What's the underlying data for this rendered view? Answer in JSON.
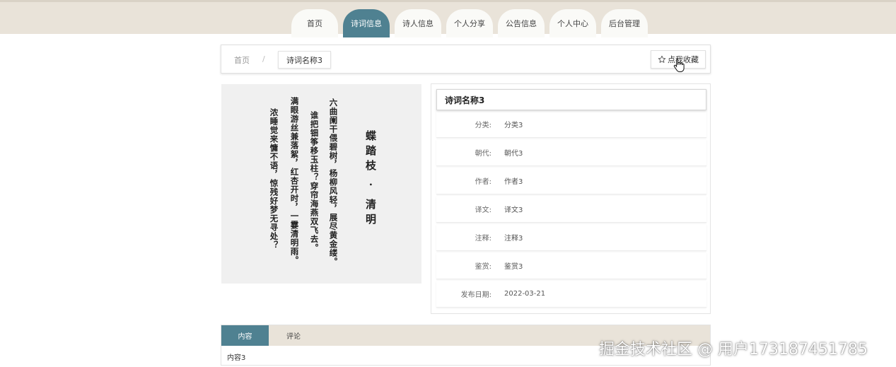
{
  "nav": {
    "items": [
      {
        "label": "首页",
        "active": false
      },
      {
        "label": "诗词信息",
        "active": true
      },
      {
        "label": "诗人信息",
        "active": false
      },
      {
        "label": "个人分享",
        "active": false
      },
      {
        "label": "公告信息",
        "active": false
      },
      {
        "label": "个人中心",
        "active": false
      },
      {
        "label": "后台管理",
        "active": false
      }
    ]
  },
  "breadcrumb": {
    "home": "首页",
    "separator": "/",
    "current": "诗词名称3"
  },
  "favorite": {
    "icon": "star-outline-icon",
    "label": "点我收藏"
  },
  "poem_image": {
    "columns": [
      "蝶踏枝 · 清明",
      "六曲阑干偎碧树，杨柳风轻，展尽黄金缕。",
      "谁把钿筝移玉柱？穿帘海燕双飞去。",
      "满眼游丝兼落絮，红杏开时，一霎清明雨。",
      "浓睡觉来慵不语，惊残好梦无寻处？"
    ]
  },
  "detail": {
    "title": "诗词名称3",
    "fields": [
      {
        "label": "分类:",
        "value": "分类3"
      },
      {
        "label": "朝代:",
        "value": "朝代3"
      },
      {
        "label": "作者:",
        "value": "作者3"
      },
      {
        "label": "译文:",
        "value": "译文3"
      },
      {
        "label": "注释:",
        "value": "注释3"
      },
      {
        "label": "鉴赏:",
        "value": "鉴赏3"
      },
      {
        "label": "发布日期:",
        "value": "2022-03-21"
      }
    ]
  },
  "tabs": {
    "items": [
      {
        "label": "内容",
        "active": true
      },
      {
        "label": "评论",
        "active": false
      }
    ],
    "content": "内容3"
  },
  "watermark": "掘金技术社区 @ 用户173187451785",
  "colors": {
    "accent": "#4f8191",
    "topbar": "#e9e3d9"
  }
}
